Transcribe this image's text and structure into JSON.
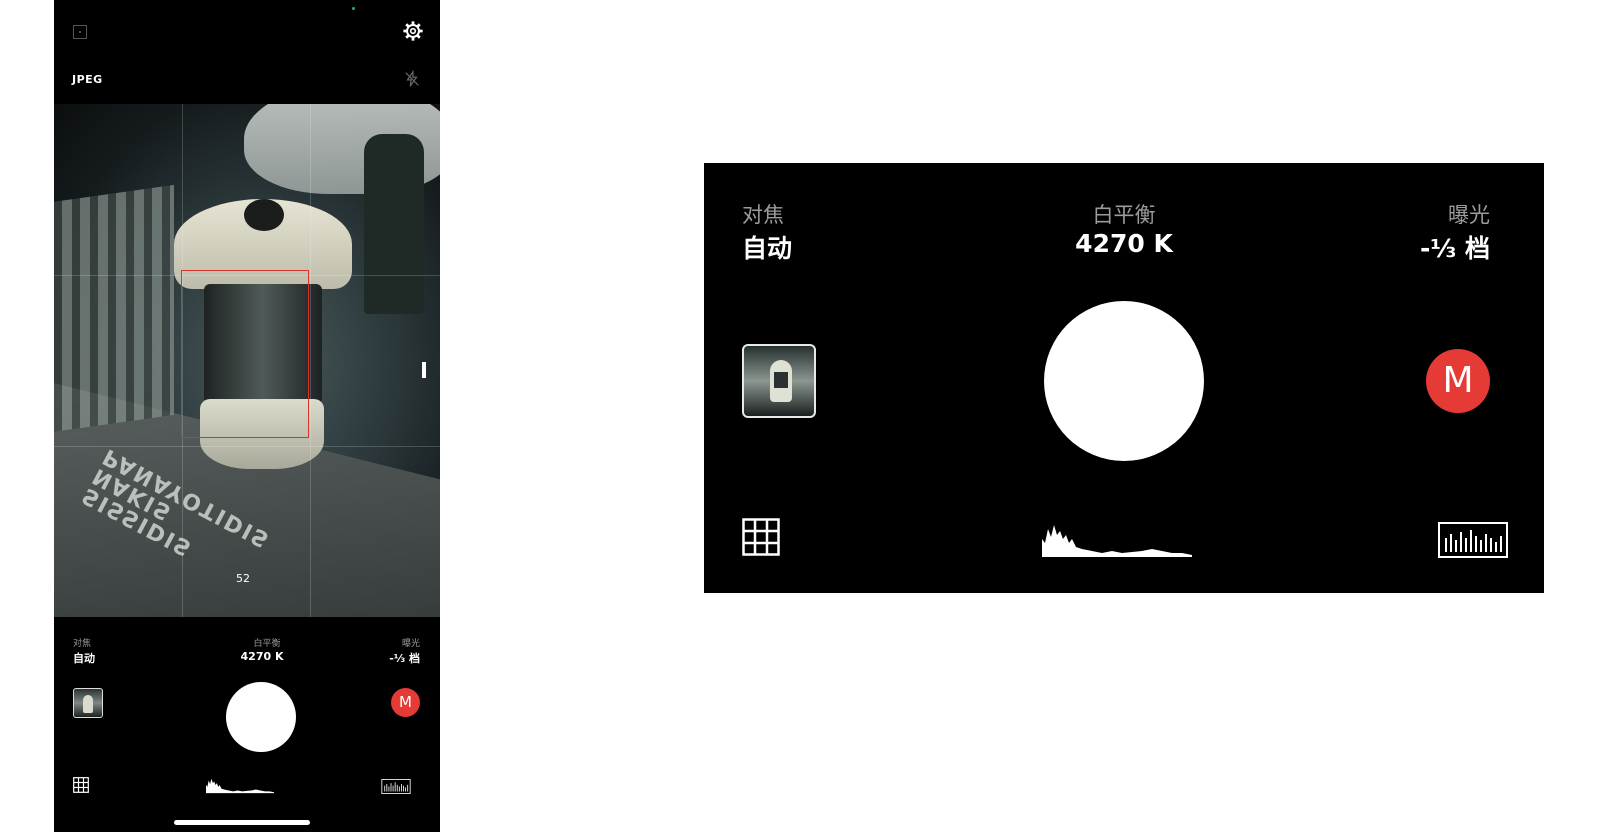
{
  "top_bar": {
    "format_label": "JPEG",
    "icons": [
      "aspect-icon",
      "gear-icon",
      "flash-off-icon"
    ]
  },
  "viewfinder": {
    "focus_distance": "52",
    "book_text": "SISSIDIS\nNAKIS\nPANAYOTIDIS"
  },
  "settings": {
    "focus": {
      "label": "对焦",
      "value": "自动"
    },
    "white_balance": {
      "label": "白平衡",
      "value": "4270 K"
    },
    "exposure": {
      "label": "曝光",
      "value": "-⅓ 档"
    }
  },
  "mode_button": {
    "label": "M"
  },
  "bottom_icons": [
    "grid-icon",
    "histogram-icon",
    "exposure-meter-icon"
  ],
  "colors": {
    "background": "#000000",
    "accent_red": "#e53a35",
    "focus_box": "#d9342b"
  }
}
